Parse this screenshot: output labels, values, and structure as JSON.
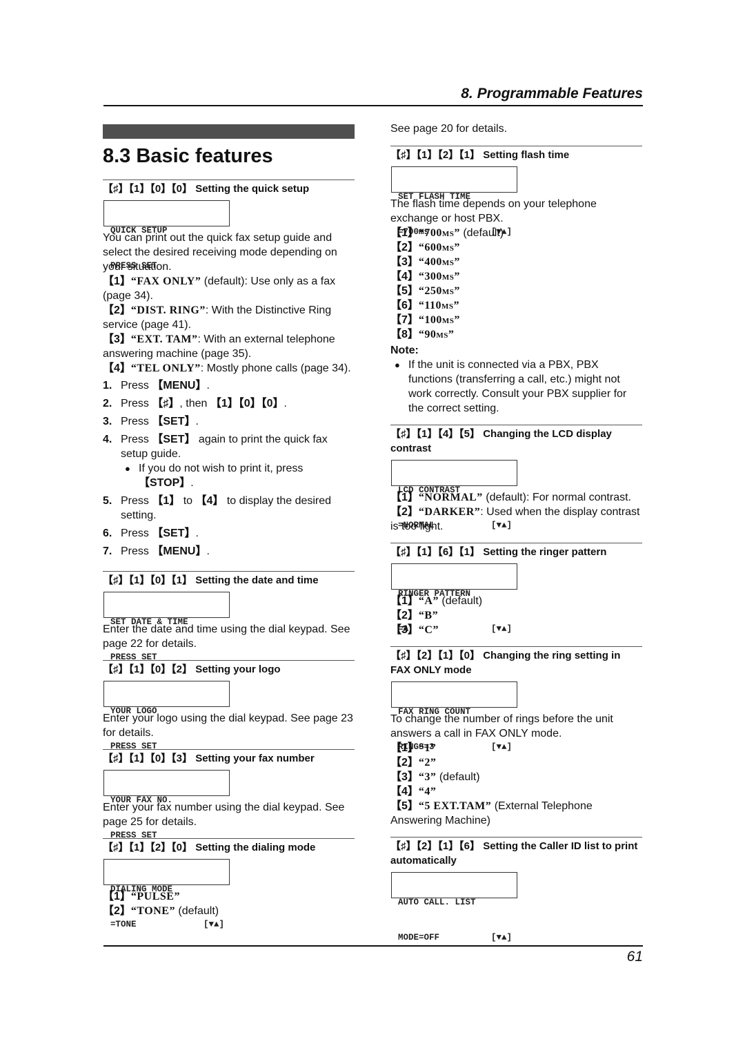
{
  "header": {
    "chapter": "8. Programmable Features"
  },
  "section_title": "8.3 Basic features",
  "left": {
    "quick_setup": {
      "code": "【♯】【1】【0】【0】",
      "title": "Setting the quick setup",
      "lcd": [
        "QUICK SETUP",
        "PRESS SET"
      ],
      "intro": "You can print out the quick fax setup guide and select the desired receiving mode depending on your situation.",
      "options": [
        {
          "key": "【1】",
          "value": "“FAX ONLY”",
          "desc": " (default): Use only as a fax (page 34)."
        },
        {
          "key": "【2】",
          "value": "“DIST. RING”",
          "desc": ": With the Distinctive Ring service (page 41)."
        },
        {
          "key": "【3】",
          "value": "“EXT. TAM”",
          "desc": ": With an external telephone answering machine (page 35)."
        },
        {
          "key": "【4】",
          "value": "“TEL ONLY”",
          "desc": ": Mostly phone calls (page 34)."
        }
      ],
      "steps": [
        {
          "num": "1.",
          "pre": "Press ",
          "key": "【MENU】",
          "post": "."
        },
        {
          "num": "2.",
          "pre": "Press ",
          "key": "【♯】",
          "post": ", then ",
          "key2": "【1】【0】【0】",
          "post2": "."
        },
        {
          "num": "3.",
          "pre": "Press ",
          "key": "【SET】",
          "post": "."
        },
        {
          "num": "4.",
          "pre": "Press ",
          "key": "【SET】",
          "post": " again to print the quick fax setup guide."
        },
        {
          "num": "5.",
          "pre": "Press ",
          "key": "【1】",
          "post": " to ",
          "key2": "【4】",
          "post2": " to display the desired setting."
        },
        {
          "num": "6.",
          "pre": "Press ",
          "key": "【SET】",
          "post": "."
        },
        {
          "num": "7.",
          "pre": "Press ",
          "key": "【MENU】",
          "post": "."
        }
      ],
      "step4_bullet": {
        "text": "If you do not wish to print it, press ",
        "key": "【STOP】",
        "post": "."
      }
    },
    "date_time": {
      "code": "【♯】【1】【0】【1】",
      "title": "Setting the date and time",
      "lcd": [
        "SET DATE & TIME",
        "PRESS SET"
      ],
      "text": "Enter the date and time using the dial keypad. See page 22 for details."
    },
    "logo": {
      "code": "【♯】【1】【0】【2】",
      "title": "Setting your logo",
      "lcd": [
        "YOUR LOGO",
        "PRESS SET"
      ],
      "text": "Enter your logo using the dial keypad. See page 23 for details."
    },
    "fax_number": {
      "code": "【♯】【1】【0】【3】",
      "title": "Setting your fax number",
      "lcd": [
        "YOUR FAX NO.",
        "PRESS SET"
      ],
      "text": "Enter your fax number using the dial keypad. See page 25 for details."
    },
    "dialing_mode": {
      "code": "【♯】【1】【2】【0】",
      "title": "Setting the dialing mode",
      "lcd": [
        "DIALING MODE",
        "=TONE",
        "[▼▲]"
      ],
      "options": [
        {
          "key": "【1】",
          "value": "“PULSE”",
          "desc": ""
        },
        {
          "key": "【2】",
          "value": "“TONE”",
          "desc": " (default)"
        }
      ]
    }
  },
  "right": {
    "continued": "See page 20 for details.",
    "flash_time": {
      "code": "【♯】【1】【2】【1】",
      "title": "Setting flash time",
      "lcd": [
        "SET FLASH TIME",
        "=700ms",
        "[▼▲]"
      ],
      "text": "The flash time depends on your telephone exchange or host PBX.",
      "options": [
        {
          "key": "【1】",
          "value": "“700ms”",
          "desc": " (default)"
        },
        {
          "key": "【2】",
          "value": "“600ms”",
          "desc": ""
        },
        {
          "key": "【3】",
          "value": "“400ms”",
          "desc": ""
        },
        {
          "key": "【4】",
          "value": "“300ms”",
          "desc": ""
        },
        {
          "key": "【5】",
          "value": "“250ms”",
          "desc": ""
        },
        {
          "key": "【6】",
          "value": "“110ms”",
          "desc": ""
        },
        {
          "key": "【7】",
          "value": "“100ms”",
          "desc": ""
        },
        {
          "key": "【8】",
          "value": "“90ms”",
          "desc": ""
        }
      ],
      "note_label": "Note:",
      "note": "If the unit is connected via a PBX, PBX functions (transferring a call, etc.) might not work correctly. Consult your PBX supplier for the correct setting."
    },
    "lcd_contrast": {
      "code": "【♯】【1】【4】【5】",
      "title": "Changing the LCD display contrast",
      "lcd": [
        "LCD CONTRAST",
        "=NORMAL",
        "[▼▲]"
      ],
      "options": [
        {
          "key": "【1】",
          "value": "“NORMAL”",
          "desc": " (default): For normal contrast."
        },
        {
          "key": "【2】",
          "value": "“DARKER”",
          "desc": ": Used when the display contrast is too light."
        }
      ]
    },
    "ringer_pattern": {
      "code": "【♯】【1】【6】【1】",
      "title": "Setting the ringer pattern",
      "lcd": [
        "RINGER PATTERN",
        "=A",
        "[▼▲]"
      ],
      "options": [
        {
          "key": "【1】",
          "value": "“A”",
          "desc": " (default)"
        },
        {
          "key": "【2】",
          "value": "“B”",
          "desc": ""
        },
        {
          "key": "【3】",
          "value": "“C”",
          "desc": ""
        }
      ]
    },
    "ring_setting": {
      "code": "【♯】【2】【1】【0】",
      "title": "Changing the ring setting in FAX ONLY mode",
      "lcd": [
        "FAX RING COUNT",
        "RINGS=3",
        "[▼▲]"
      ],
      "text": "To change the number of rings before the unit answers a call in FAX ONLY mode.",
      "options": [
        {
          "key": "【1】",
          "value": "“1”",
          "desc": ""
        },
        {
          "key": "【2】",
          "value": "“2”",
          "desc": ""
        },
        {
          "key": "【3】",
          "value": "“3”",
          "desc": " (default)"
        },
        {
          "key": "【4】",
          "value": "“4”",
          "desc": ""
        },
        {
          "key": "【5】",
          "value": "“5 EXT.TAM”",
          "desc": " (External Telephone Answering Machine)"
        }
      ]
    },
    "caller_id": {
      "code": "【♯】【2】【1】【6】",
      "title": "Setting the Caller ID list to print automatically",
      "lcd": [
        "AUTO CALL. LIST",
        "MODE=OFF",
        "[▼▲]"
      ]
    }
  },
  "footer": {
    "page_number": "61"
  }
}
